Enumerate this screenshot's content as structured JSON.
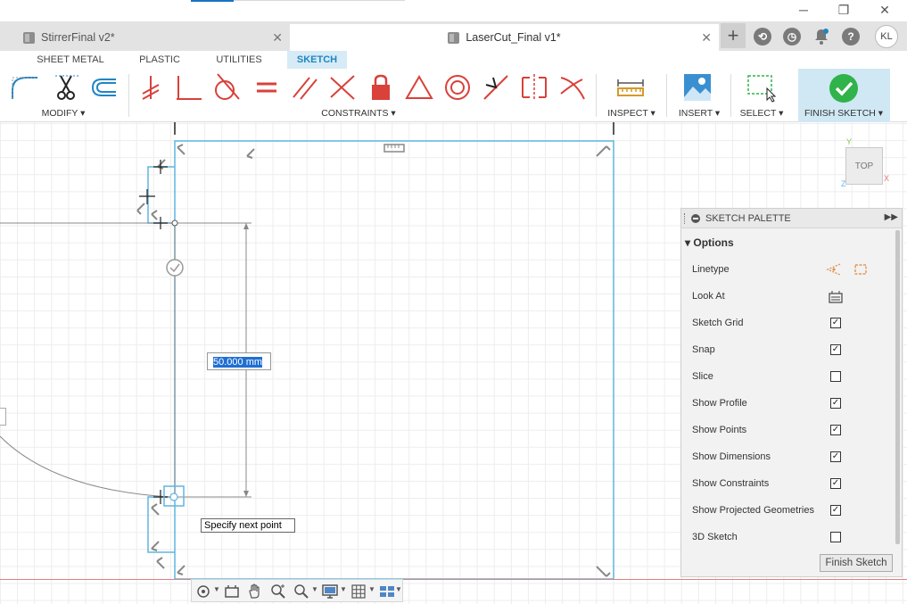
{
  "titlebar": {
    "minimize": "─",
    "restore": "❐",
    "close": "✕",
    "accent_color": "#1a72c2"
  },
  "tabs": [
    {
      "label": "StirrerFinal v2*",
      "close": "✕"
    },
    {
      "label": "LaserCut_Final v1*",
      "close": "✕"
    }
  ],
  "tabbar_icons": {
    "plus": "+",
    "user_initials": "KL"
  },
  "toolbar": {
    "workspaces": [
      "SHEET METAL",
      "PLASTIC",
      "UTILITIES",
      "SKETCH"
    ],
    "groups": {
      "modify": "MODIFY ▾",
      "constraints": "CONSTRAINTS ▾",
      "inspect": "INSPECT ▾",
      "insert": "INSERT ▾",
      "select": "SELECT ▾",
      "finish": "FINISH SKETCH ▾"
    }
  },
  "canvas": {
    "dimension_value": "50.000 mm",
    "tooltip": "Specify next point"
  },
  "viewcube": {
    "face": "TOP",
    "y": "Y",
    "x": "X",
    "z": "Z"
  },
  "palette": {
    "title": "SKETCH PALETTE",
    "section": "Options",
    "rows": [
      {
        "label": "Linetype",
        "type": "icons"
      },
      {
        "label": "Look At",
        "type": "icon"
      },
      {
        "label": "Sketch Grid",
        "checked": true
      },
      {
        "label": "Snap",
        "checked": true
      },
      {
        "label": "Slice",
        "checked": false
      },
      {
        "label": "Show Profile",
        "checked": true
      },
      {
        "label": "Show Points",
        "checked": true
      },
      {
        "label": "Show Dimensions",
        "checked": true
      },
      {
        "label": "Show Constraints",
        "checked": true
      },
      {
        "label": "Show Projected Geometries",
        "checked": true
      },
      {
        "label": "3D Sketch",
        "checked": false
      }
    ],
    "finish_button": "Finish Sketch"
  },
  "colors": {
    "sketch_line": "#5fb6e0",
    "constraint_red": "#d9413a",
    "finish_green": "#2fb34a",
    "accent_blue": "#1f86c3"
  }
}
